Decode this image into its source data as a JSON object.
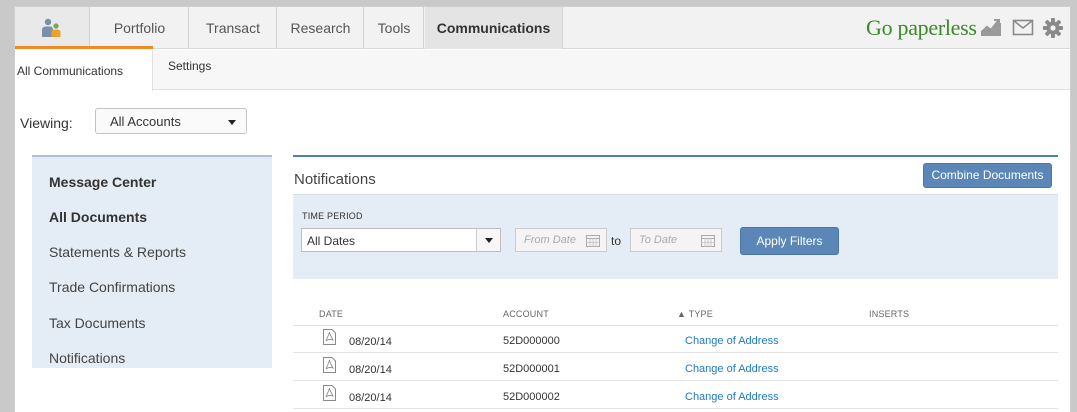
{
  "nav": {
    "tabs": [
      {
        "label": "Portfolio"
      },
      {
        "label": "Transact"
      },
      {
        "label": "Research"
      },
      {
        "label": "Tools"
      },
      {
        "label": "Communications",
        "active": true
      }
    ],
    "brand_text": "Go paperless",
    "icons": [
      "person-account-icon",
      "chart-trend-icon",
      "envelope-icon",
      "gear-icon"
    ],
    "accent_color": "#f08a24",
    "brand_color": "#3a8a2a"
  },
  "subtabs": {
    "all": "All Communications",
    "settings": "Settings"
  },
  "viewing": {
    "label": "Viewing:",
    "selected": "All Accounts"
  },
  "sidebar": {
    "items": [
      {
        "label": "Message Center",
        "bold": true
      },
      {
        "label": "All Documents",
        "bold": true
      },
      {
        "label": "Statements & Reports"
      },
      {
        "label": "Trade Confirmations"
      },
      {
        "label": "Tax Documents"
      },
      {
        "label": "Notifications"
      }
    ]
  },
  "notifications": {
    "title": "Notifications",
    "combine_button": "Combine Documents",
    "time_period_label": "TIME PERIOD",
    "time_period_selected": "All Dates",
    "from_placeholder": "From Date",
    "to_label": "to",
    "to_placeholder": "To Date",
    "apply_button": "Apply Filters",
    "button_color": "#5b87b8"
  },
  "table": {
    "headers": {
      "date": "DATE",
      "account": "ACCOUNT",
      "type": "▲ TYPE",
      "inserts": "INSERTS"
    },
    "rows": [
      {
        "date": "08/20/14",
        "account": "52D000000",
        "type": "Change of Address"
      },
      {
        "date": "08/20/14",
        "account": "52D000001",
        "type": "Change of Address"
      },
      {
        "date": "08/20/14",
        "account": "52D000002",
        "type": "Change of Address"
      }
    ],
    "link_color": "#1d7bc1"
  }
}
